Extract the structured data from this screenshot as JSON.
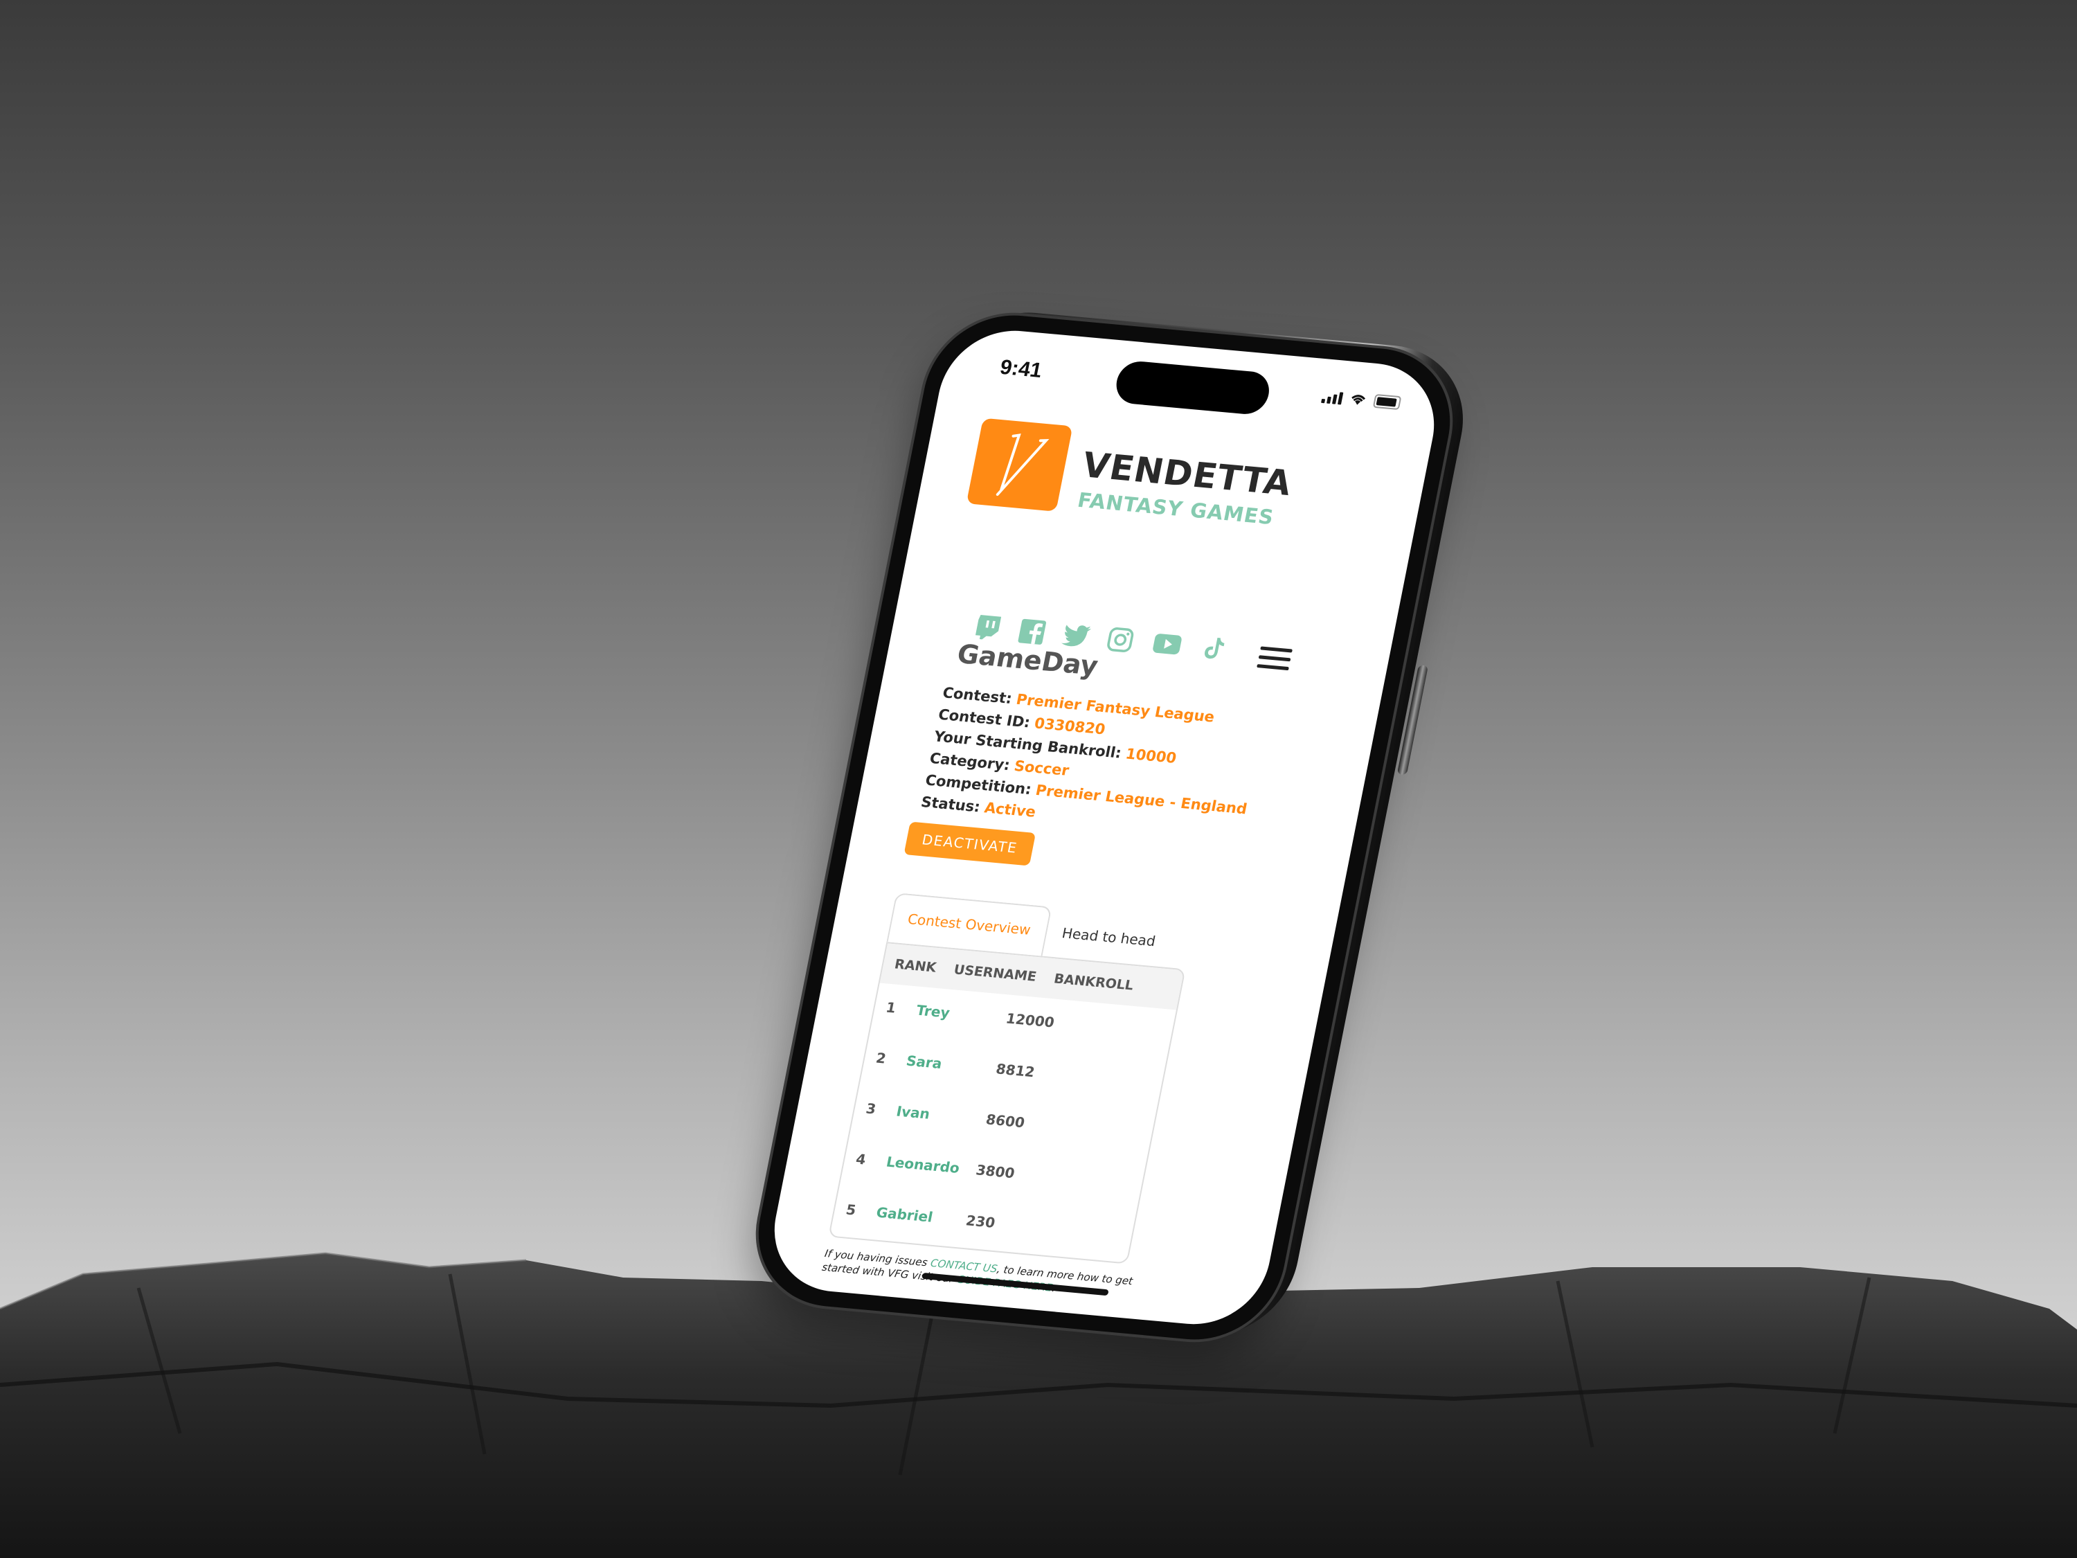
{
  "status_bar": {
    "time": "9:41"
  },
  "brand": {
    "title": "VENDETTA",
    "subtitle": "FANTASY GAMES",
    "logo_letter": "V",
    "colors": {
      "orange": "#ff8a14",
      "teal": "#86cbb0",
      "dark": "#2a2a2a"
    }
  },
  "social": [
    {
      "name": "twitch-icon"
    },
    {
      "name": "facebook-icon"
    },
    {
      "name": "twitter-icon"
    },
    {
      "name": "instagram-icon"
    },
    {
      "name": "youtube-icon"
    },
    {
      "name": "tiktok-icon"
    }
  ],
  "page": {
    "title": "GameDay",
    "info": [
      {
        "label": "Contest:",
        "value": "Premier Fantasy League"
      },
      {
        "label": "Contest ID:",
        "value": "0330820"
      },
      {
        "label": "Your Starting Bankroll:",
        "value": "10000"
      },
      {
        "label": "Category:",
        "value": "Soccer"
      },
      {
        "label": "Competition:",
        "value": "Premier League - England"
      },
      {
        "label": "Status:",
        "value": "Active"
      }
    ],
    "deactivate_label": "DEACTIVATE"
  },
  "tabs": [
    {
      "label": "Contest Overview",
      "active": true
    },
    {
      "label": "Head to head",
      "active": false
    }
  ],
  "table": {
    "headers": [
      "RANK",
      "USERNAME",
      "BANKROLL"
    ],
    "rows": [
      {
        "rank": "1",
        "username": "Trey",
        "bankroll": "12000"
      },
      {
        "rank": "2",
        "username": "Sara",
        "bankroll": "8812"
      },
      {
        "rank": "3",
        "username": "Ivan",
        "bankroll": "8600"
      },
      {
        "rank": "4",
        "username": "Leonardo",
        "bankroll": "3800"
      },
      {
        "rank": "5",
        "username": "Gabriel",
        "bankroll": "230"
      }
    ]
  },
  "footer": {
    "text1": "If you having issues ",
    "link1": "CONTACT US",
    "text2": ", to learn more how to get started with VFG visit our ",
    "link2": "GUIDE PAEG HERE",
    "text3": "."
  }
}
